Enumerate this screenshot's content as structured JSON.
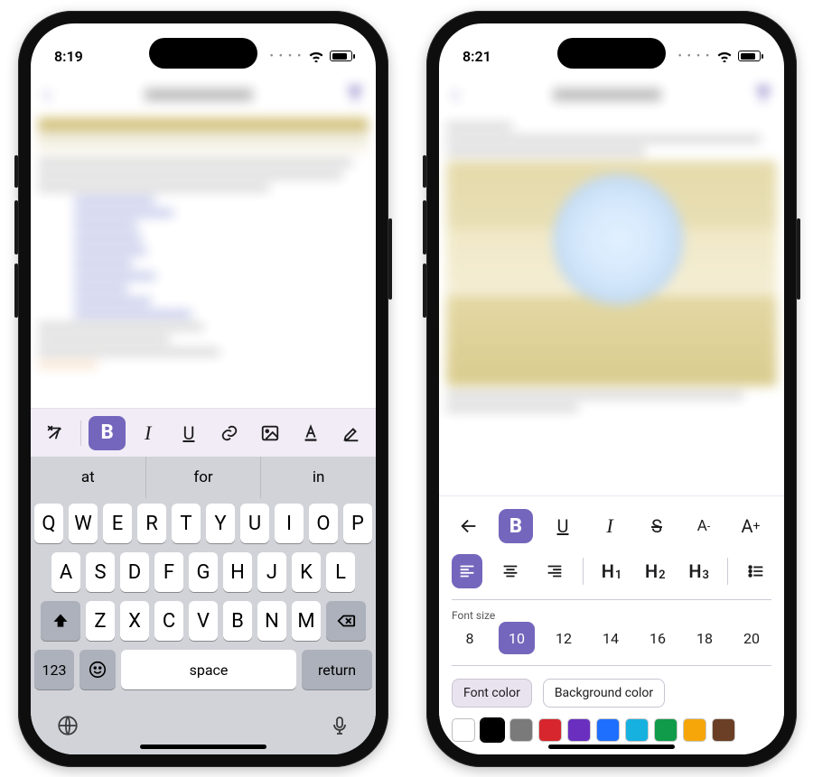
{
  "colors": {
    "accent": "#7466bc"
  },
  "left": {
    "status": {
      "time": "8:19"
    },
    "toolbar": {
      "items": [
        {
          "name": "clear-format",
          "active": false
        },
        {
          "name": "bold",
          "label": "B",
          "active": true
        },
        {
          "name": "italic",
          "label": "I",
          "active": false
        },
        {
          "name": "underline",
          "label": "U",
          "active": false
        },
        {
          "name": "link",
          "active": false
        },
        {
          "name": "image",
          "active": false
        },
        {
          "name": "text-color",
          "label": "A",
          "active": false
        },
        {
          "name": "highlight",
          "active": false
        }
      ]
    },
    "suggestions": [
      "at",
      "for",
      "in"
    ],
    "keyboard": {
      "row1": [
        "Q",
        "W",
        "E",
        "R",
        "T",
        "Y",
        "U",
        "I",
        "O",
        "P"
      ],
      "row2": [
        "A",
        "S",
        "D",
        "F",
        "G",
        "H",
        "J",
        "K",
        "L"
      ],
      "row3_shift": "⇧",
      "row3": [
        "Z",
        "X",
        "C",
        "V",
        "B",
        "N",
        "M"
      ],
      "row3_del": "⌫",
      "numKey": "123",
      "emojiKey": "😀",
      "spaceKey": "space",
      "returnKey": "return",
      "globeKey": "🌐",
      "micKey": "🎤"
    }
  },
  "right": {
    "status": {
      "time": "8:21"
    },
    "row1": {
      "back": "←",
      "items": [
        {
          "name": "bold",
          "label": "B",
          "active": true
        },
        {
          "name": "underline",
          "label": "U",
          "active": false
        },
        {
          "name": "italic",
          "label": "I",
          "active": false
        },
        {
          "name": "strikethrough",
          "label": "S",
          "active": false
        },
        {
          "name": "font-smaller",
          "label": "A-",
          "active": false
        },
        {
          "name": "font-larger",
          "label": "A+",
          "active": false
        }
      ]
    },
    "row2": {
      "align": [
        {
          "name": "align-left",
          "active": true
        },
        {
          "name": "align-center",
          "active": false
        },
        {
          "name": "align-right",
          "active": false
        }
      ],
      "headings": [
        {
          "name": "h1",
          "main": "H",
          "sub": "1"
        },
        {
          "name": "h2",
          "main": "H",
          "sub": "2"
        },
        {
          "name": "h3",
          "main": "H",
          "sub": "3"
        }
      ],
      "list": {
        "name": "bulleted-list"
      }
    },
    "fontSize": {
      "label": "Font size",
      "options": [
        "8",
        "10",
        "12",
        "14",
        "16",
        "18",
        "20"
      ],
      "selected": "10"
    },
    "colorSeg": {
      "fontColor": "Font color",
      "bgColor": "Background color",
      "active": "font"
    },
    "swatches": [
      {
        "hex": "#ffffff",
        "name": "white",
        "selected": false
      },
      {
        "hex": "#000000",
        "name": "black",
        "selected": true
      },
      {
        "hex": "#7a7a7a",
        "name": "gray",
        "selected": false
      },
      {
        "hex": "#d7262d",
        "name": "red",
        "selected": false
      },
      {
        "hex": "#6a2fbf",
        "name": "purple",
        "selected": false
      },
      {
        "hex": "#1f6fff",
        "name": "blue",
        "selected": false
      },
      {
        "hex": "#17b1e0",
        "name": "cyan",
        "selected": false
      },
      {
        "hex": "#0f9b4a",
        "name": "green",
        "selected": false
      },
      {
        "hex": "#f6a609",
        "name": "orange",
        "selected": false
      },
      {
        "hex": "#6b3f25",
        "name": "brown",
        "selected": false
      }
    ]
  }
}
